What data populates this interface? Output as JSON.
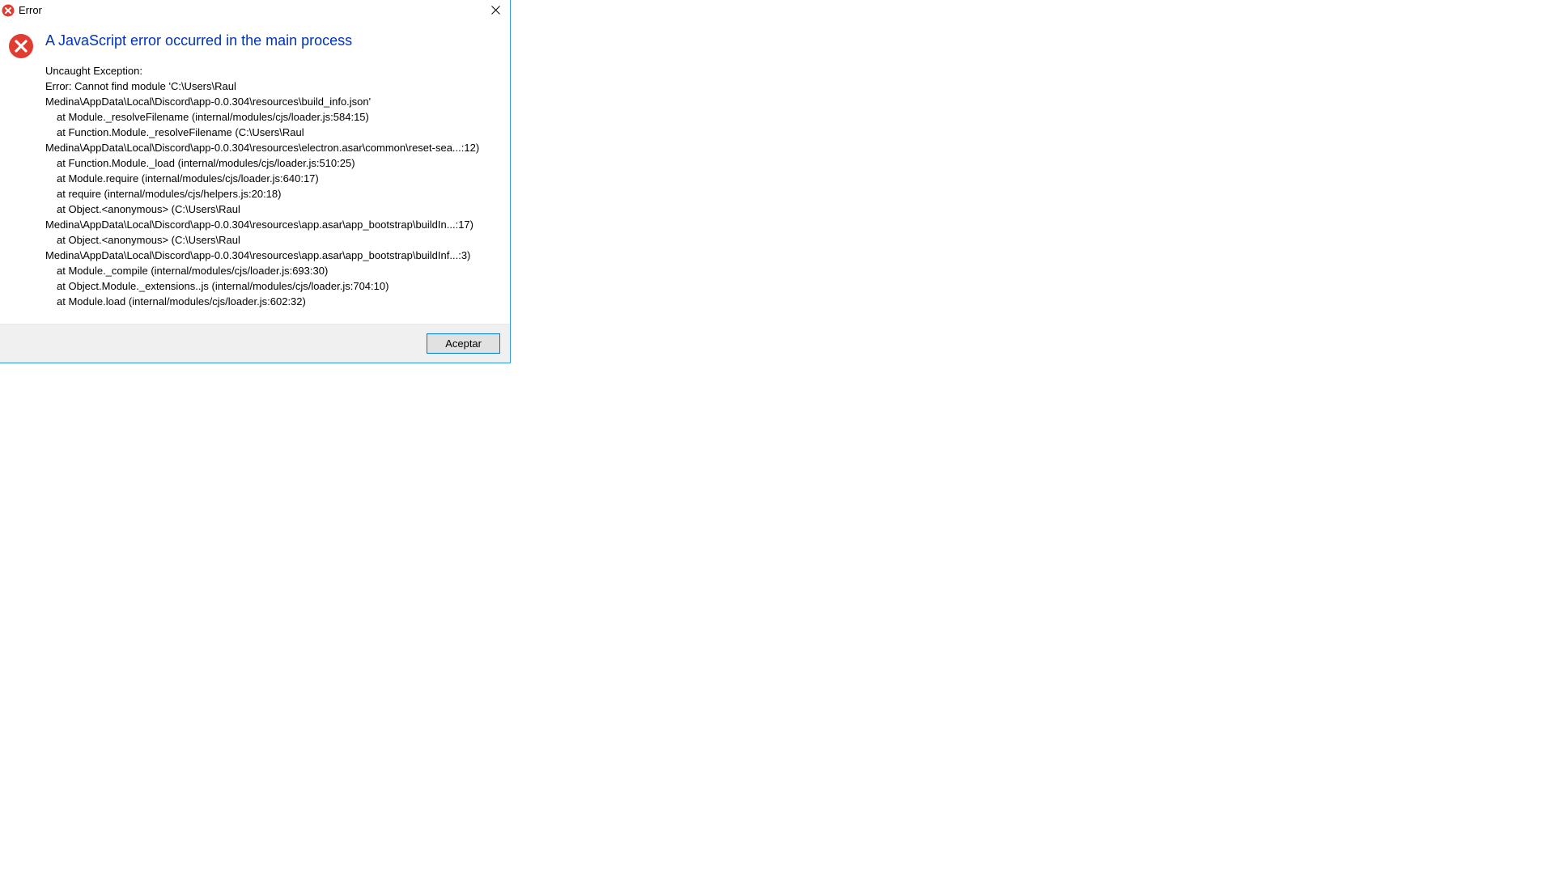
{
  "titlebar": {
    "title": "Error"
  },
  "dialog": {
    "heading": "A JavaScript error occurred in the main process",
    "exception_label": "Uncaught Exception:",
    "error_line1": "Error: Cannot find module 'C:\\Users\\Raul",
    "error_line2": "Medina\\AppData\\Local\\Discord\\app-0.0.304\\resources\\build_info.json'",
    "stack": [
      "at Module._resolveFilename (internal/modules/cjs/loader.js:584:15)",
      "at Function.Module._resolveFilename (C:\\Users\\Raul"
    ],
    "cont1": "Medina\\AppData\\Local\\Discord\\app-0.0.304\\resources\\electron.asar\\common\\reset-sea...:12)",
    "stack2": [
      "at Function.Module._load (internal/modules/cjs/loader.js:510:25)",
      "at Module.require (internal/modules/cjs/loader.js:640:17)",
      "at require (internal/modules/cjs/helpers.js:20:18)",
      "at Object.<anonymous> (C:\\Users\\Raul"
    ],
    "cont2": "Medina\\AppData\\Local\\Discord\\app-0.0.304\\resources\\app.asar\\app_bootstrap\\buildIn...:17)",
    "stack3": [
      "at Object.<anonymous> (C:\\Users\\Raul"
    ],
    "cont3": "Medina\\AppData\\Local\\Discord\\app-0.0.304\\resources\\app.asar\\app_bootstrap\\buildInf...:3)",
    "stack4": [
      "at Module._compile (internal/modules/cjs/loader.js:693:30)",
      "at Object.Module._extensions..js (internal/modules/cjs/loader.js:704:10)",
      "at Module.load (internal/modules/cjs/loader.js:602:32)"
    ]
  },
  "footer": {
    "accept_label": "Aceptar"
  },
  "colors": {
    "heading": "#0033bb",
    "error_icon": "#e03c31",
    "accent": "#0078d7"
  }
}
